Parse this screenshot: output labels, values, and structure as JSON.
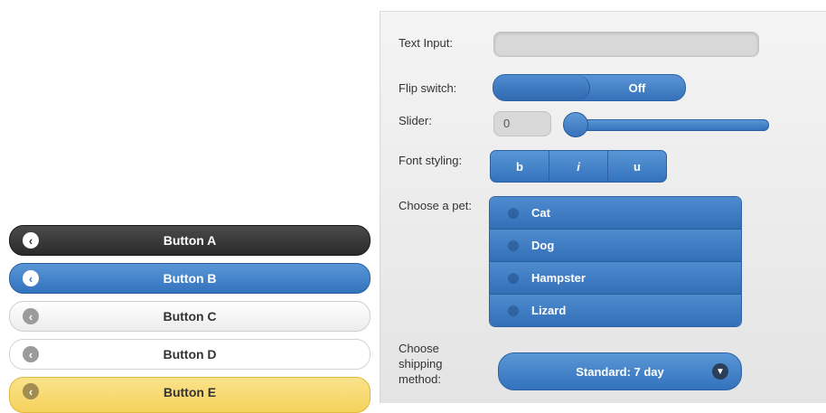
{
  "buttons": [
    {
      "label": "Button A",
      "theme": "dark",
      "icon": "chevron-left-icon"
    },
    {
      "label": "Button B",
      "theme": "blue",
      "icon": "chevron-left-icon"
    },
    {
      "label": "Button C",
      "theme": "light",
      "icon": "chevron-left-icon"
    },
    {
      "label": "Button D",
      "theme": "white",
      "icon": "chevron-left-icon"
    },
    {
      "label": "Button E",
      "theme": "yellow",
      "icon": "chevron-left-icon"
    }
  ],
  "form": {
    "text_input": {
      "label": "Text Input:",
      "value": ""
    },
    "flip_switch": {
      "label": "Flip switch:",
      "state": "Off"
    },
    "slider": {
      "label": "Slider:",
      "value": "0"
    },
    "font_styling": {
      "label": "Font styling:",
      "options": [
        "b",
        "i",
        "u"
      ]
    },
    "pet": {
      "label": "Choose a pet:",
      "options": [
        "Cat",
        "Dog",
        "Hampster",
        "Lizard"
      ]
    },
    "shipping": {
      "label": "Choose shipping method:",
      "value": "Standard: 7 day",
      "icon": "chevron-down-icon"
    }
  },
  "colors": {
    "accent": "#3a79c3",
    "dark": "#333333",
    "yellow": "#f5d25c"
  }
}
